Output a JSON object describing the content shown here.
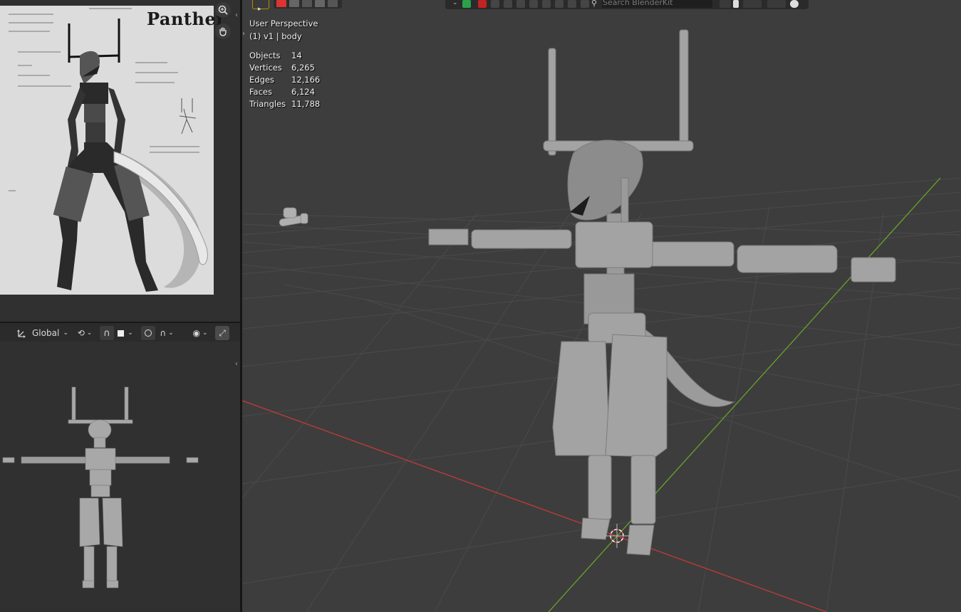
{
  "image_editor": {
    "reference_title": "Panther"
  },
  "mini_header": {
    "orientation_label": "Global"
  },
  "viewport": {
    "view_name": "User Perspective",
    "object_line": "(1) v1 | body",
    "search_placeholder": "Search BlenderKit",
    "stats": [
      {
        "label": "Objects",
        "value": "14"
      },
      {
        "label": "Vertices",
        "value": "6,265"
      },
      {
        "label": "Edges",
        "value": "12,166"
      },
      {
        "label": "Faces",
        "value": "6,124"
      },
      {
        "label": "Triangles",
        "value": "11,788"
      }
    ]
  },
  "colors": {
    "x_axis": "#c43a3a",
    "y_axis": "#6aa329",
    "grid": "#4a4a4a",
    "model": "#9a9a9a"
  }
}
